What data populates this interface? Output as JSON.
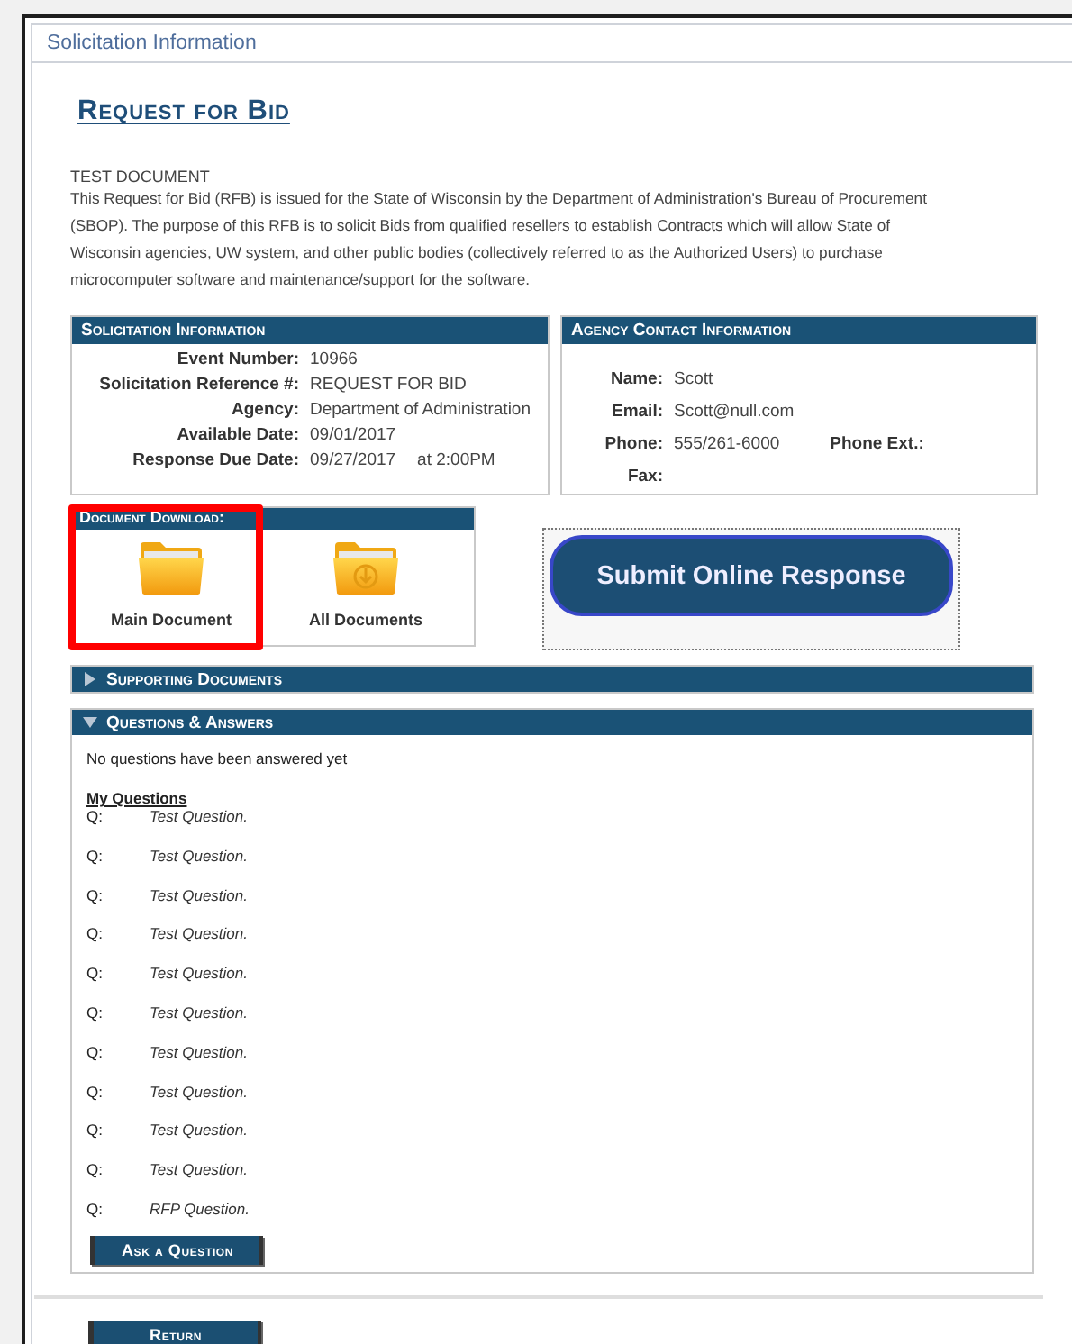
{
  "panel_title": "Solicitation Information",
  "heading": "Request for Bid",
  "document_label": "TEST DOCUMENT",
  "description": "This Request for Bid (RFB) is issued for the State of Wisconsin by the Department of Administration's Bureau of Procurement (SBOP). The purpose of this RFB is to solicit Bids from qualified resellers to establish Contracts which will allow State of Wisconsin agencies, UW system, and other public bodies (collectively referred to as the Authorized Users) to purchase microcomputer software and maintenance/support for the software.",
  "solicitation_info": {
    "title": "Solicitation Information",
    "fields": [
      {
        "label": "Event Number:",
        "value": "10966"
      },
      {
        "label": "Solicitation Reference #:",
        "value": "REQUEST FOR BID"
      },
      {
        "label": "Agency:",
        "value": "Department of Administration"
      },
      {
        "label": "Available Date:",
        "value": "09/01/2017"
      },
      {
        "label": "Response Due Date:",
        "value": "09/27/2017",
        "extra": "at 2:00PM"
      }
    ]
  },
  "agency_contact": {
    "title": "Agency Contact Information",
    "fields": [
      {
        "label": "Name:",
        "value": "Scott"
      },
      {
        "label": "Email:",
        "value": "Scott@null.com"
      },
      {
        "label": "Phone:",
        "value": "555/261-6000",
        "extra": "Phone Ext.:"
      },
      {
        "label": "Fax:"
      }
    ]
  },
  "document_download": {
    "title": "Document Download:",
    "items": [
      {
        "label": "Main Document",
        "kind": "folder",
        "highlighted": true
      },
      {
        "label": "All Documents",
        "kind": "download-folder",
        "highlighted": false
      }
    ]
  },
  "submit_button": "Submit Online Response",
  "sections": [
    {
      "title": "Supporting Documents",
      "expanded": false
    },
    {
      "title": "Questions & Answers",
      "expanded": true,
      "status": "No questions have been answered yet",
      "my_questions_title": "My Questions",
      "questions": [
        {
          "prefix": "Q:",
          "text": "Test Question."
        },
        {
          "prefix": "Q:",
          "text": "Test Question."
        },
        {
          "prefix": "Q:",
          "text": "Test Question."
        },
        {
          "prefix": "Q:",
          "text": "Test Question."
        },
        {
          "prefix": "Q:",
          "text": "Test Question."
        },
        {
          "prefix": "Q:",
          "text": "Test Question."
        },
        {
          "prefix": "Q:",
          "text": "Test Question."
        },
        {
          "prefix": "Q:",
          "text": "Test Question."
        },
        {
          "prefix": "Q:",
          "text": "Test Question."
        },
        {
          "prefix": "Q:",
          "text": "Test Question."
        },
        {
          "prefix": "Q:",
          "text": "RFP Question."
        }
      ],
      "ask_button": "Ask a Question"
    }
  ],
  "return_button": "Return"
}
